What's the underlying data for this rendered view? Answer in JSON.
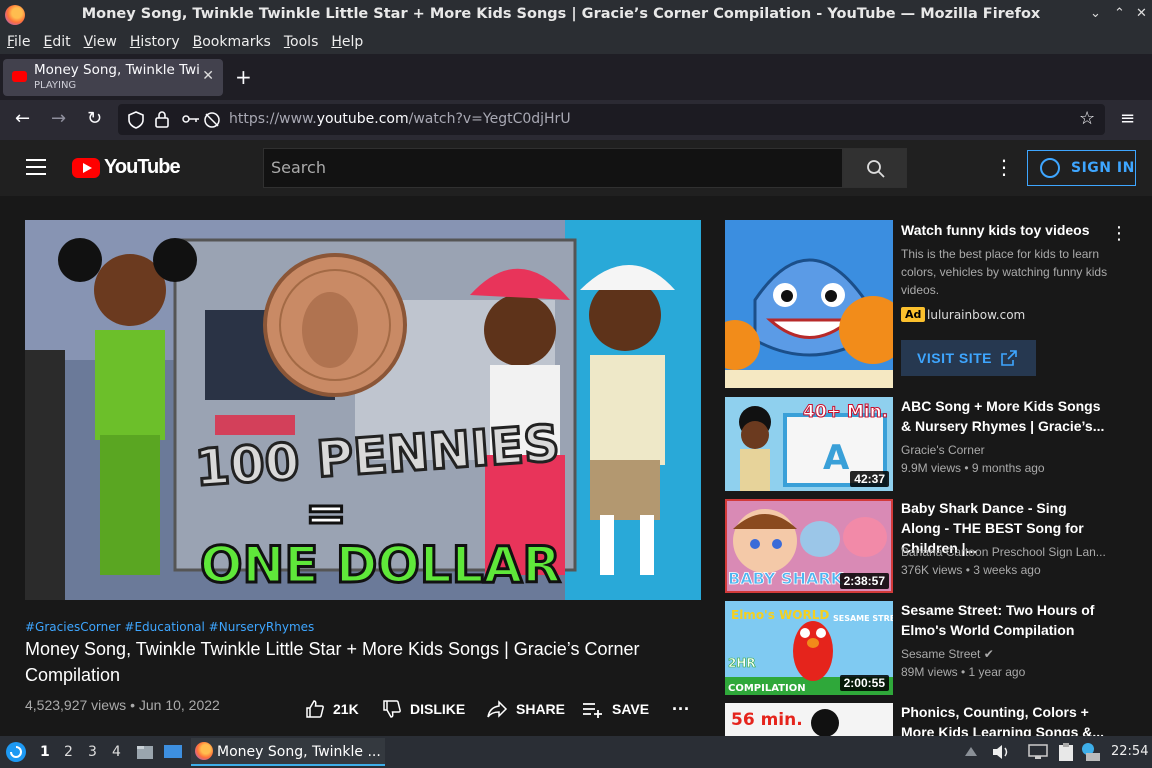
{
  "window": {
    "title": "Money Song, Twinkle Twinkle Little Star + More Kids Songs | Gracie’s Corner Compilation - YouTube — Mozilla Firefox",
    "controls": [
      "⌄",
      "⌃",
      "✕"
    ]
  },
  "menu": [
    "File",
    "Edit",
    "View",
    "History",
    "Bookmarks",
    "Tools",
    "Help"
  ],
  "tab": {
    "title": "Money Song, Twinkle Twinkle Little Star",
    "status": "PLAYING",
    "close": "✕",
    "new_tab": "+"
  },
  "nav": {
    "back": "←",
    "forward": "→",
    "reload": "↻",
    "url_prefix": "https://www.",
    "url_domain": "youtube.com",
    "url_path": "/watch?v=YegtC0djHrU",
    "bookmark_star": "☆",
    "app_menu": "≡"
  },
  "youtube": {
    "logo_text": "YouTube",
    "search_placeholder": "Search",
    "search_icon": "⌕",
    "more_icon": "⋮",
    "sign_in": "SIGN IN"
  },
  "video": {
    "thumbnail_text_top": "100 PENNIES",
    "thumbnail_text_mid": "=",
    "thumbnail_text_bottom": "ONE DOLLAR",
    "hashtags": "#GraciesCorner #Educational #NurseryRhymes",
    "title": "Money Song, Twinkle Twinkle Little Star + More Kids Songs | Gracie’s Corner Compilation",
    "views": "4,523,927 views • Jun 10, 2022",
    "likes": "21K",
    "dislike": "DISLIKE",
    "share": "SHARE",
    "save": "SAVE",
    "more": "···"
  },
  "ad": {
    "title": "Watch funny kids toy videos",
    "description": "This is the best place for kids to learn colors, vehicles by watching funny kids videos.",
    "badge": "Ad",
    "domain": "lulurainbow.com",
    "button": "VISIT SITE",
    "menu": "⋮"
  },
  "sidebar": [
    {
      "title": "ABC Song + More Kids Songs & Nursery Rhymes | Gracie’s...",
      "channel": "Gracie's Corner",
      "meta": "9.9M views • 9 months ago",
      "duration": "42:37",
      "thumb_text": "40+ Min."
    },
    {
      "title": "Baby Shark Dance - Sing Along - THE BEST Song for Children |...",
      "channel": "Banana Cartoon Preschool Sign Lan...",
      "meta": "376K views • 3 weeks ago",
      "duration": "2:38:57",
      "thumb_text": "BABY SHARK"
    },
    {
      "title": "Sesame Street: Two Hours of Elmo's World Compilation",
      "channel": "Sesame Street ✔",
      "meta": "89M views • 1 year ago",
      "duration": "2:00:55",
      "thumb_text": "Elmo's WORLD",
      "thumb_text2": "2HR",
      "thumb_text3": "COMPILATION",
      "thumb_text4": "SESAME STREET"
    },
    {
      "title": "Phonics, Counting, Colors + More Kids Learning Songs &...",
      "thumb_text": "56 min."
    }
  ],
  "taskbar": {
    "workspaces": [
      "1",
      "2",
      "3",
      "4"
    ],
    "active_window": "Money Song, Twinkle ...",
    "clock": "22:54"
  }
}
